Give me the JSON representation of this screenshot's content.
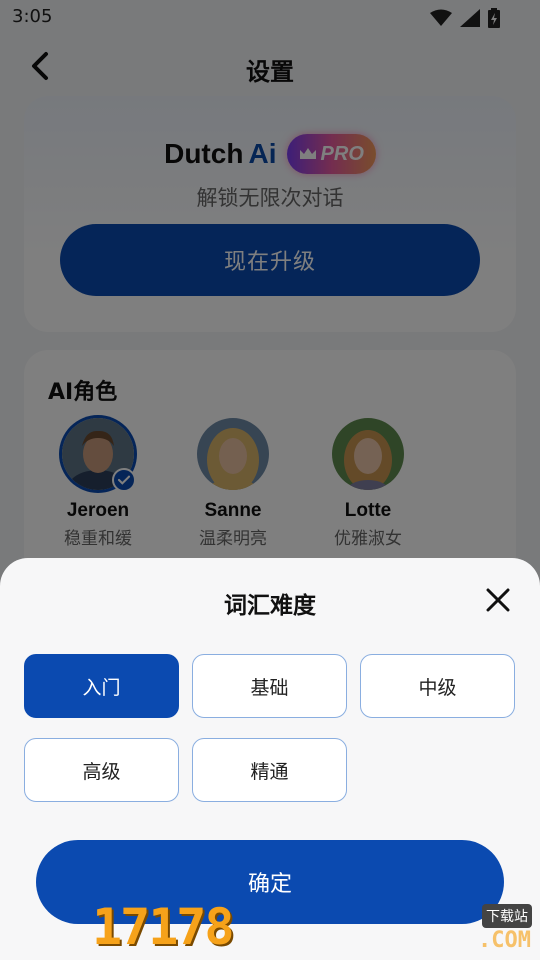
{
  "status_bar": {
    "time": "3:05"
  },
  "header": {
    "title": "设置"
  },
  "pro_card": {
    "brand_name": "Dutch",
    "brand_ai": "Ai",
    "badge": "PRO",
    "subtitle": "解锁无限次对话",
    "upgrade_label": "现在升级"
  },
  "roles": {
    "title": "AI角色",
    "items": [
      {
        "name": "Jeroen",
        "desc": "稳重和缓",
        "selected": true
      },
      {
        "name": "Sanne",
        "desc": "温柔明亮",
        "selected": false
      },
      {
        "name": "Lotte",
        "desc": "优雅淑女",
        "selected": false
      }
    ]
  },
  "sheet": {
    "title": "词汇难度",
    "options": [
      "入门",
      "基础",
      "中级",
      "高级",
      "精通"
    ],
    "selected_index": 0,
    "confirm_label": "确定"
  },
  "watermark": {
    "number": "17178",
    "com": ".COM",
    "tag": "下载站"
  },
  "colors": {
    "primary": "#0b4ab0",
    "overlay": "rgba(0,0,0,0.5)"
  }
}
